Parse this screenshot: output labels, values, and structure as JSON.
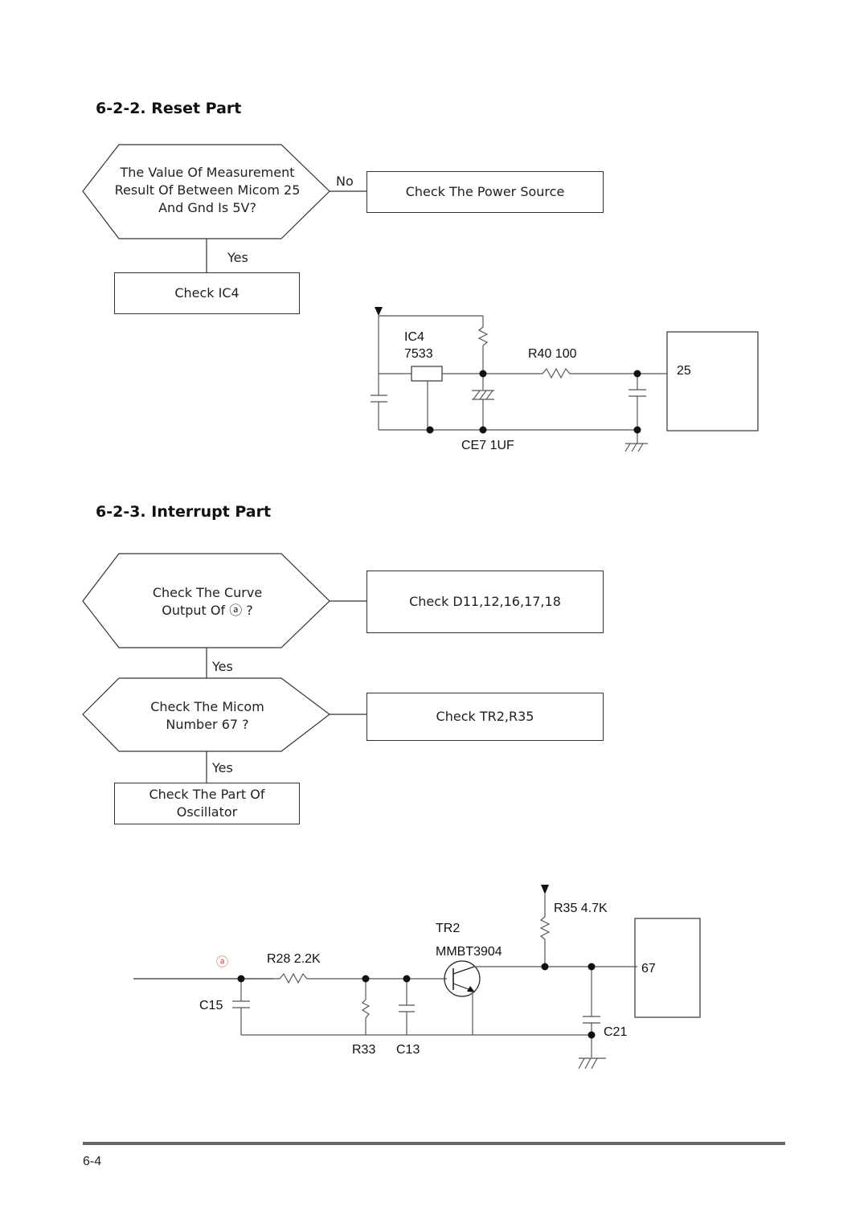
{
  "reset_part": {
    "title": "6-2-2. Reset Part",
    "decision": {
      "line1": "The Value Of Measurement",
      "line2": "Result Of Between Micom 25",
      "line3": "And Gnd Is 5V?"
    },
    "no_label": "No",
    "yes_label": "Yes",
    "no_action": "Check The Power Source",
    "yes_action": "Check IC4",
    "schematic": {
      "ic_ref": "IC4",
      "ic_part": "7533",
      "resistor": "R40  100",
      "capacitor": "CE7  1UF",
      "micom_pin": "25"
    }
  },
  "interrupt_part": {
    "title": "6-2-3. Interrupt Part",
    "decision1": {
      "line1": "Check The Curve",
      "line2": "Output Of ⓐ ?"
    },
    "action1": "Check D11,12,16,17,18",
    "yes1_label": "Yes",
    "decision2": {
      "line1": "Check The Micom",
      "line2": "Number 67 ?"
    },
    "action2": "Check TR2,R35",
    "yes2_label": "Yes",
    "final_action": {
      "line1": "Check The Part Of",
      "line2": "Oscillator"
    },
    "schematic": {
      "point_marker": "ⓐ",
      "r28": "R28  2.2K",
      "c15": "C15",
      "r33": "R33",
      "c13": "C13",
      "tr_ref": "TR2",
      "tr_part": "MMBT3904",
      "r35": "R35  4.7K",
      "c21": "C21",
      "micom_pin": "67"
    }
  },
  "footer": {
    "page_number": "6-4"
  }
}
